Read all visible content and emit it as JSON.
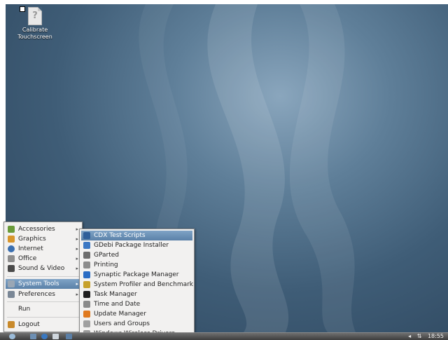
{
  "desktop": {
    "icon_label": "Calibrate Touchscreen",
    "icon_glyph": "?"
  },
  "main_menu": {
    "items": [
      {
        "label": "Accessories",
        "icon": "accessories-icon",
        "color": "#6a9b3a",
        "has_submenu": true
      },
      {
        "label": "Graphics",
        "icon": "graphics-icon",
        "color": "#d8962c",
        "has_submenu": true
      },
      {
        "label": "Internet",
        "icon": "internet-icon",
        "color": "#3a6fb0",
        "has_submenu": true
      },
      {
        "label": "Office",
        "icon": "office-icon",
        "color": "#8e8e8e",
        "has_submenu": true
      },
      {
        "label": "Sound & Video",
        "icon": "sound-video-icon",
        "color": "#4a4a4a",
        "has_submenu": true
      },
      {
        "label": "System Tools",
        "icon": "system-tools-icon",
        "color": "#9aa7b5",
        "has_submenu": true,
        "selected": true
      },
      {
        "label": "Preferences",
        "icon": "preferences-icon",
        "color": "#7a8796",
        "has_submenu": true
      },
      {
        "label": "Run",
        "icon": "",
        "has_submenu": false
      },
      {
        "label": "Logout",
        "icon": "logout-icon",
        "color": "#c98a2b",
        "has_submenu": false
      }
    ]
  },
  "system_tools_menu": {
    "items": [
      {
        "label": "CDX Test Scripts",
        "icon": "terminal-icon",
        "color": "#2f5f9a",
        "selected": true
      },
      {
        "label": "GDebi Package Installer",
        "icon": "package-icon",
        "color": "#3b78c4"
      },
      {
        "label": "GParted",
        "icon": "disk-icon",
        "color": "#6d6d6d"
      },
      {
        "label": "Printing",
        "icon": "printer-icon",
        "color": "#8c8c8c"
      },
      {
        "label": "Synaptic Package Manager",
        "icon": "synaptic-icon",
        "color": "#2a6cc4"
      },
      {
        "label": "System Profiler and Benchmark",
        "icon": "profiler-icon",
        "color": "#c7a12c"
      },
      {
        "label": "Task Manager",
        "icon": "task-manager-icon",
        "color": "#1f1f1f"
      },
      {
        "label": "Time and Date",
        "icon": "clock-icon",
        "color": "#8a8a8a"
      },
      {
        "label": "Update Manager",
        "icon": "update-icon",
        "color": "#e07a1f"
      },
      {
        "label": "Users and Groups",
        "icon": "users-icon",
        "color": "#a0a0a0"
      },
      {
        "label": "Windows Wireless Drivers",
        "icon": "wireless-driver-icon",
        "color": "#9a9a9a"
      }
    ]
  },
  "panel": {
    "clock": "18:55",
    "volume_glyph": "◂",
    "network_glyph": "⇅"
  }
}
